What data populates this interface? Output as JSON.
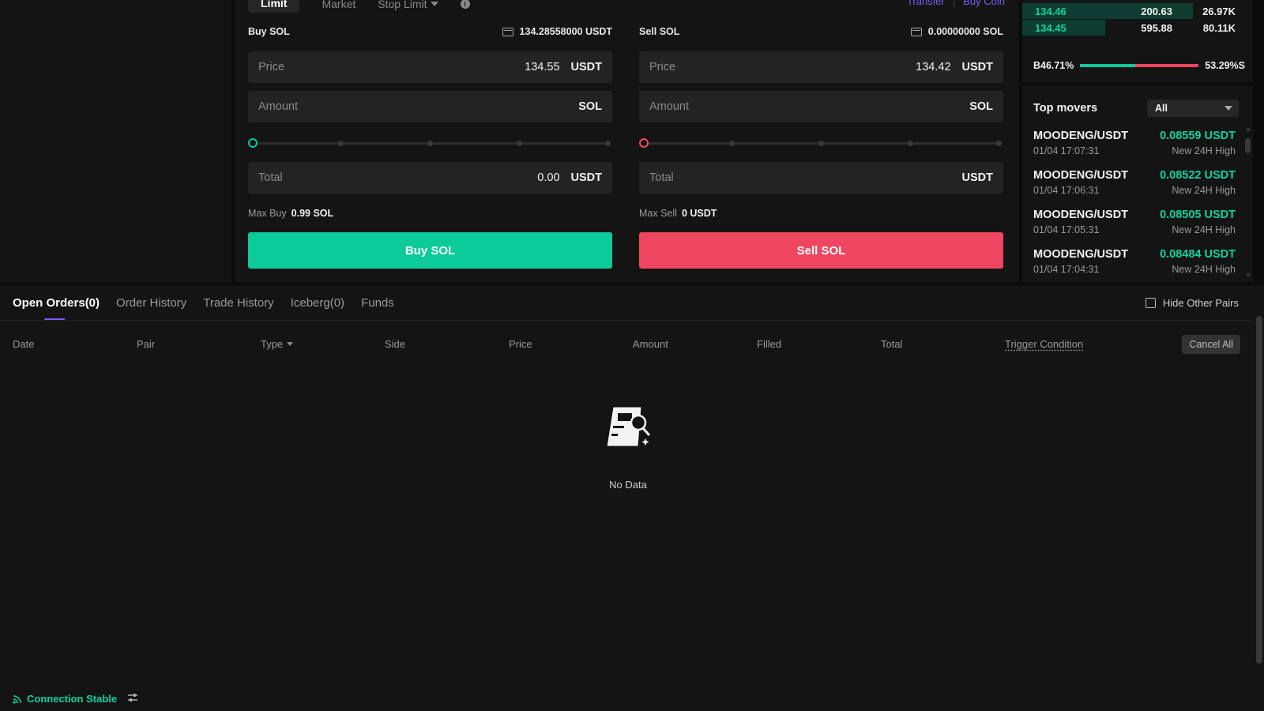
{
  "order_tabs": {
    "limit": "Limit",
    "market": "Market",
    "stop_limit": "Stop Limit",
    "info": "i"
  },
  "links": {
    "transfer": "Transfer",
    "buy_coin": "Buy Coin"
  },
  "buy": {
    "title": "Buy SOL",
    "balance": "134.28558000 USDT",
    "price_label": "Price",
    "price_value": "134.55",
    "price_unit": "USDT",
    "amount_label": "Amount",
    "amount_unit": "SOL",
    "total_label": "Total",
    "total_value": "0.00",
    "total_unit": "USDT",
    "max_label": "Max Buy",
    "max_value": "0.99 SOL",
    "button": "Buy SOL",
    "slider_fraction": 0
  },
  "sell": {
    "title": "Sell SOL",
    "balance": "0.00000000 SOL",
    "price_label": "Price",
    "price_value": "134.42",
    "price_unit": "USDT",
    "amount_label": "Amount",
    "amount_unit": "SOL",
    "total_label": "Total",
    "total_value": "",
    "total_unit": "USDT",
    "max_label": "Max Sell",
    "max_value": "0 USDT",
    "button": "Sell SOL",
    "slider_fraction": 0
  },
  "orderbook": {
    "rows": [
      {
        "price": "134.46",
        "qty": "200.63",
        "total": "26.97K",
        "depth": 0.74
      },
      {
        "price": "134.45",
        "qty": "595.88",
        "total": "80.11K",
        "depth": 0.36
      }
    ],
    "buy_ratio": "B46.71%",
    "sell_ratio": "53.29%S",
    "buy_fraction": 0.4671
  },
  "top_movers": {
    "title": "Top movers",
    "filter": "All",
    "items": [
      {
        "pair": "MOODENG/USDT",
        "price": "0.08559 USDT",
        "time": "01/04 17:07:31",
        "note": "New 24H High"
      },
      {
        "pair": "MOODENG/USDT",
        "price": "0.08522 USDT",
        "time": "01/04 17:06:31",
        "note": "New 24H High"
      },
      {
        "pair": "MOODENG/USDT",
        "price": "0.08505 USDT",
        "time": "01/04 17:05:31",
        "note": "New 24H High"
      },
      {
        "pair": "MOODENG/USDT",
        "price": "0.08484 USDT",
        "time": "01/04 17:04:31",
        "note": "New 24H High"
      }
    ]
  },
  "bottom_tabs": [
    "Open Orders(0)",
    "Order History",
    "Trade History",
    "Iceberg(0)",
    "Funds"
  ],
  "hide_other_pairs": "Hide Other Pairs",
  "columns": [
    "Date",
    "Pair",
    "Type",
    "Side",
    "Price",
    "Amount",
    "Filled",
    "Total",
    "Trigger Condition"
  ],
  "cancel_all": "Cancel All",
  "empty_text": "No Data",
  "connection": "Connection Stable",
  "colors": {
    "buy": "#0ccb98",
    "sell": "#ee4560",
    "accent": "#7b5cff"
  }
}
